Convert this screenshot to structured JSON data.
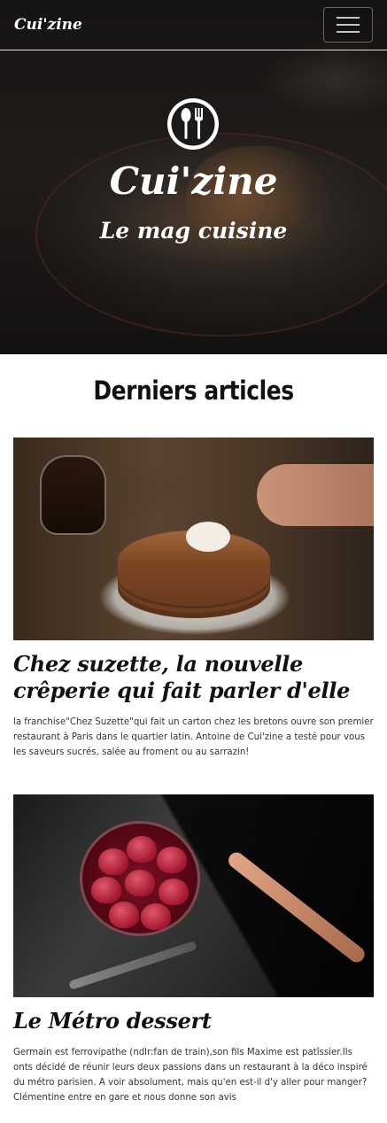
{
  "navbar": {
    "brand": "Cui'zine",
    "menu_icon": "hamburger-menu-icon"
  },
  "hero": {
    "logo_icon": "spoon-fork-icon",
    "title": "Cui'zine",
    "subtitle": "Le mag cuisine"
  },
  "articles_section": {
    "title": "Derniers articles",
    "items": [
      {
        "image": "pancakes-photo",
        "title": "Chez suzette, la nouvelle crêperie qui fait parler d'elle",
        "text": "la franchise\"Chez Suzette\"qui fait un carton chez les bretons ouvre son premier restaurant à Paris dans le quartier latin. Antoine de Cui'zine a testé pour vous les saveurs sucrés, salée au froment ou au sarrazin!"
      },
      {
        "image": "strawberry-dessert-photo",
        "title": "Le Métro dessert",
        "text": "Germain est ferrovipathe (ndlr:fan de train),son fils Maxime est patîssier.Ils onts décidé de réunir leurs deux passions dans un restaurant à la déco inspiré du métro parisien. A voir absolument, mais qu'en est-il d'y aller pour manger? Clémentine entre en gare et nous donne son avis"
      }
    ]
  }
}
